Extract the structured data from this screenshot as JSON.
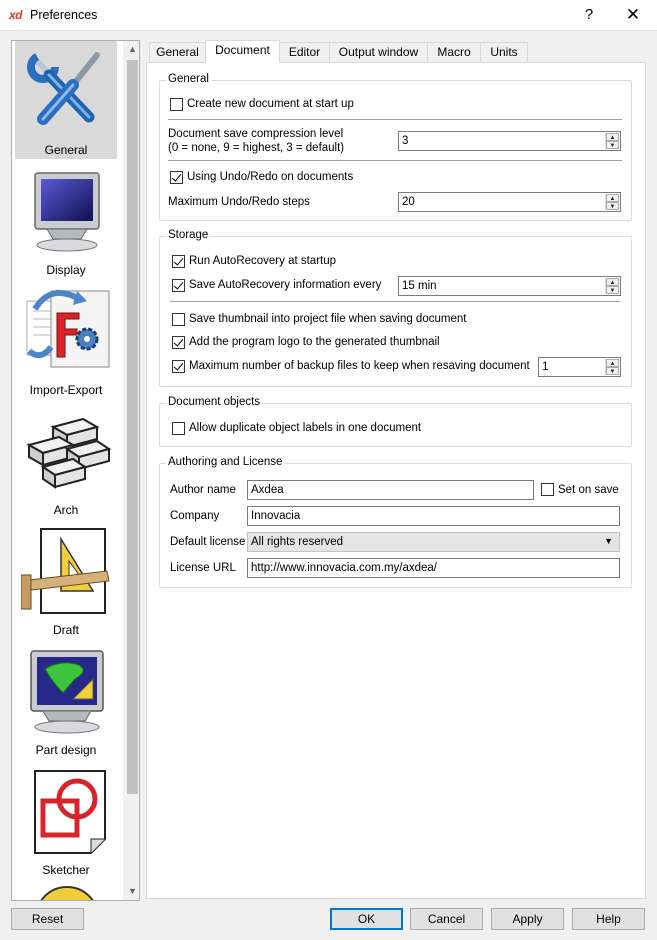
{
  "window": {
    "logo": "xd",
    "title": "Preferences",
    "help": "?",
    "close": "✕"
  },
  "sidebar": {
    "items": [
      {
        "label": "General",
        "icon": "tools-icon",
        "selected": true
      },
      {
        "label": "Display",
        "icon": "monitor-icon"
      },
      {
        "label": "Import-Export",
        "icon": "import-export-icon"
      },
      {
        "label": "Arch",
        "icon": "bricks-icon"
      },
      {
        "label": "Draft",
        "icon": "draft-ruler-icon"
      },
      {
        "label": "Part design",
        "icon": "part-design-icon"
      },
      {
        "label": "Sketcher",
        "icon": "sketcher-icon"
      }
    ]
  },
  "tabs": [
    {
      "label": "General"
    },
    {
      "label": "Document",
      "active": true
    },
    {
      "label": "Editor"
    },
    {
      "label": "Output window"
    },
    {
      "label": "Macro"
    },
    {
      "label": "Units"
    }
  ],
  "general_group": {
    "title": "General",
    "create_new_doc": {
      "label": "Create new document at start up",
      "checked": false
    },
    "compression": {
      "label_line1": "Document save compression level",
      "label_line2": "(0 = none, 9 = highest, 3 = default)",
      "value": "3"
    },
    "undo_redo": {
      "label": "Using Undo/Redo on documents",
      "checked": true
    },
    "max_undo": {
      "label": "Maximum Undo/Redo steps",
      "value": "20"
    }
  },
  "storage_group": {
    "title": "Storage",
    "run_autorecovery": {
      "label": "Run AutoRecovery at startup",
      "checked": true
    },
    "save_autorecovery": {
      "label": "Save AutoRecovery information every",
      "checked": true,
      "value": "15 min"
    },
    "save_thumbnail": {
      "label": "Save thumbnail into project file when saving document",
      "checked": false
    },
    "add_logo": {
      "label": "Add the program logo to the generated thumbnail",
      "checked": true
    },
    "max_backup": {
      "label": "Maximum number of backup files to keep when resaving document",
      "checked": true,
      "value": "1"
    }
  },
  "docobjects_group": {
    "title": "Document objects",
    "allow_duplicate": {
      "label": "Allow duplicate object labels in one document",
      "checked": false
    }
  },
  "authoring_group": {
    "title": "Authoring and License",
    "author": {
      "label": "Author name",
      "value": "Axdea"
    },
    "set_on_save": {
      "label": "Set on save",
      "checked": false
    },
    "company": {
      "label": "Company",
      "value": "Innovacia"
    },
    "license": {
      "label": "Default license",
      "value": "All rights reserved"
    },
    "license_url": {
      "label": "License URL",
      "value": "http://www.innovacia.com.my/axdea/"
    }
  },
  "buttons": {
    "reset": "Reset",
    "ok": "OK",
    "cancel": "Cancel",
    "apply": "Apply",
    "help": "Help"
  },
  "colors": {
    "accent": "#0078d7",
    "selected_bg": "#d9d9d9",
    "logo": "#e03c1e"
  }
}
